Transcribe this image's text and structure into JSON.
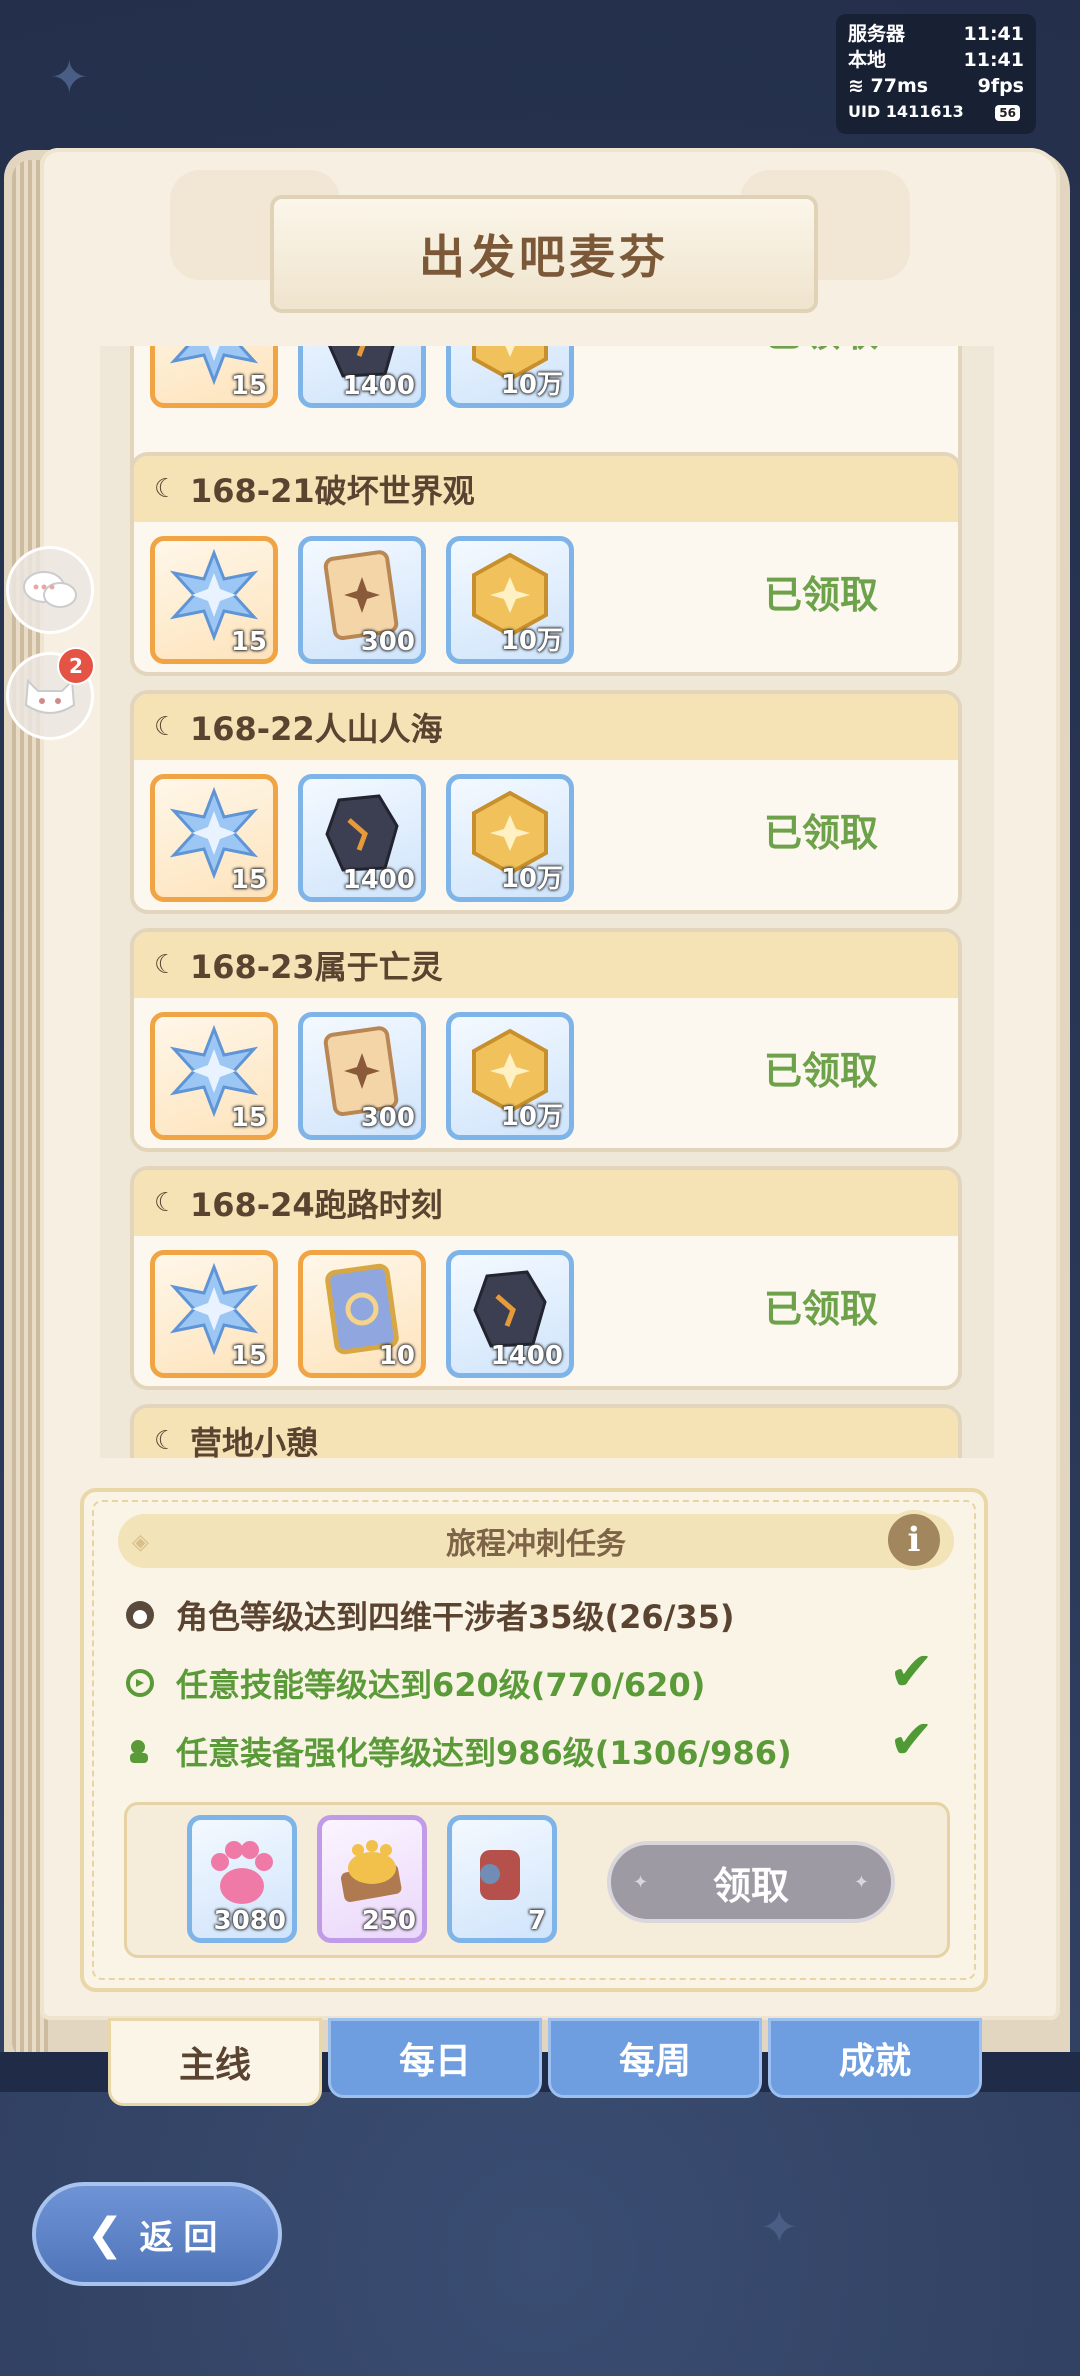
{
  "status": {
    "server_label": "服务器",
    "server_time": "11:41",
    "local_label": "本地",
    "local_time": "11:41",
    "ping": "77ms",
    "fps": "9fps",
    "uid": "UID 1411613",
    "battery": "56"
  },
  "title": "出发吧麦芬",
  "side": {
    "badge_count": "2"
  },
  "cards": [
    {
      "title": "",
      "claimed": "已领取",
      "rewards": [
        {
          "type": "star",
          "qty": "15"
        },
        {
          "type": "ore",
          "qty": "1400"
        },
        {
          "type": "coin",
          "qty": "10万"
        }
      ]
    },
    {
      "title": "168-21破坏世界观",
      "claimed": "已领取",
      "rewards": [
        {
          "type": "star",
          "qty": "15"
        },
        {
          "type": "card",
          "qty": "300"
        },
        {
          "type": "coin",
          "qty": "10万"
        }
      ]
    },
    {
      "title": "168-22人山人海",
      "claimed": "已领取",
      "rewards": [
        {
          "type": "star",
          "qty": "15"
        },
        {
          "type": "ore",
          "qty": "1400"
        },
        {
          "type": "coin",
          "qty": "10万"
        }
      ]
    },
    {
      "title": "168-23属于亡灵",
      "claimed": "已领取",
      "rewards": [
        {
          "type": "star",
          "qty": "15"
        },
        {
          "type": "card",
          "qty": "300"
        },
        {
          "type": "coin",
          "qty": "10万"
        }
      ]
    },
    {
      "title": "168-24跑路时刻",
      "claimed": "已领取",
      "rewards": [
        {
          "type": "star",
          "qty": "15"
        },
        {
          "type": "ticket",
          "qty": "10"
        },
        {
          "type": "ore",
          "qty": "1400"
        }
      ]
    },
    {
      "title": "营地小憩",
      "claimed": "",
      "rewards": []
    }
  ],
  "mission": {
    "title": "旅程冲刺任务",
    "info": "i",
    "tasks": [
      {
        "text": "角色等级达到四维干涉者35级(26/35)",
        "done": false
      },
      {
        "text": "任意技能等级达到620级(770/620)",
        "done": true
      },
      {
        "text": "任意装备强化等级达到986级(1306/986)",
        "done": true
      }
    ],
    "rewards": [
      {
        "type": "paw",
        "qty": "3080"
      },
      {
        "type": "gold",
        "qty": "250"
      },
      {
        "type": "item",
        "qty": "7"
      }
    ],
    "claim_label": "领取"
  },
  "tabs": [
    {
      "label": "主线",
      "active": true
    },
    {
      "label": "每日",
      "active": false
    },
    {
      "label": "每周",
      "active": false
    },
    {
      "label": "成就",
      "active": false
    }
  ],
  "back_label": "返回",
  "colors": {
    "claimed": "#6ea24a",
    "check": "#4f9a34",
    "tab_active": "#fbf5e8",
    "tab": "#6e9ee0"
  }
}
